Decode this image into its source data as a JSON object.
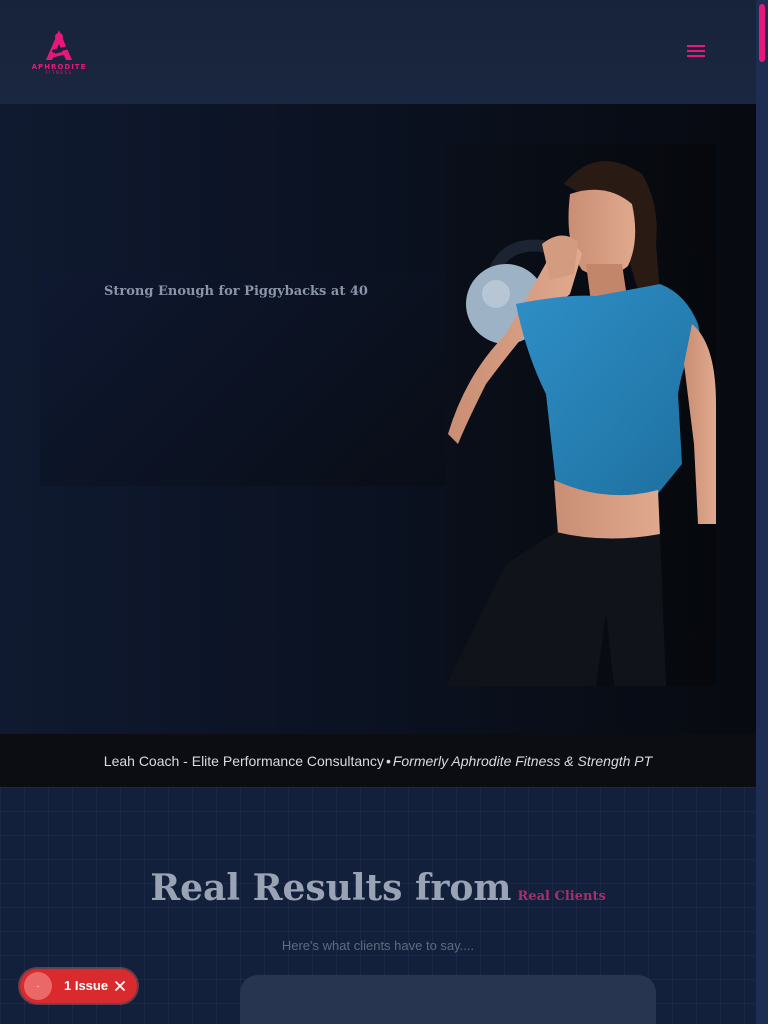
{
  "header": {
    "logo_name": "APHRODITE",
    "logo_tagline": "FITNESS",
    "menu_icon": "hamburger-menu-icon"
  },
  "hero": {
    "headline": "Strong Enough for Piggybacks at 40",
    "photo": "woman-with-kettlebell-photo"
  },
  "banner": {
    "text": "Leah Coach - Elite Performance Consultancy",
    "separator": "•",
    "formerly": "Formerly Aphrodite Fitness & Strength PT"
  },
  "results": {
    "title": "Real Results from",
    "title_accent": "Real Clients",
    "subtitle": "Here's what clients have to say...."
  },
  "issue_badge": {
    "count_label": "1 Issue",
    "circle_text": ".",
    "close_icon": "close-icon"
  },
  "colors": {
    "accent": "#e8177a",
    "header_bg": "#17233a",
    "banner_bg": "#0b0d12",
    "issue_red": "#d92a2e"
  }
}
